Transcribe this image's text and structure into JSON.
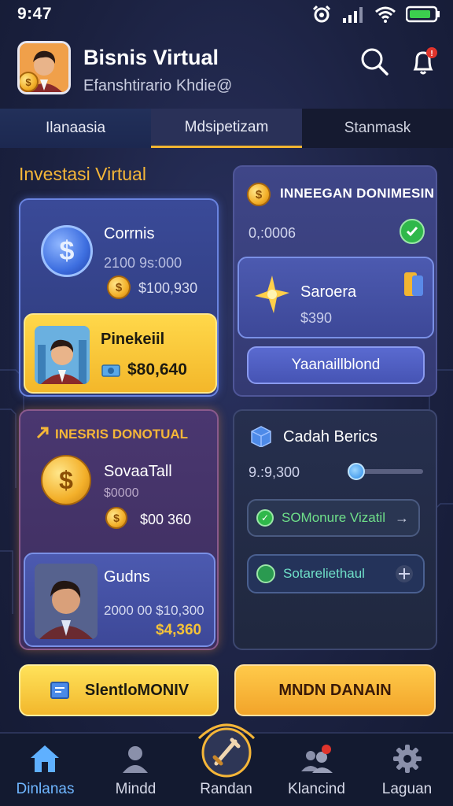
{
  "status_bar": {
    "time": "9:47"
  },
  "header": {
    "title": "Bisnis Virtual",
    "subtitle": "Efanshtirario Khdie@"
  },
  "tabs": [
    {
      "label": "Ilanaasia"
    },
    {
      "label": "Mdsipetizam"
    },
    {
      "label": "Stanmask"
    }
  ],
  "section_title": "Investasi Virtual",
  "card_currency": {
    "title": "Corrnis",
    "value1": "2100 9s:000",
    "value2": "$100,930"
  },
  "card_yellow": {
    "title": "Pinekeiil",
    "value": "$80,640"
  },
  "card_investment": {
    "title": "INNEEGAN DONIMESIN",
    "value": "0,:0006",
    "inner_title": "Saroera",
    "inner_value": "$390",
    "button_label": "Yaanaillblond"
  },
  "card_purple": {
    "title": "INESRIS DONOTUAL",
    "item_title": "SovaaTall",
    "item_sub": "$0000",
    "item_value": "$00 360"
  },
  "card_person": {
    "title": "Gudns",
    "value1": "2000 00 $10,300",
    "value2": "$4,360"
  },
  "card_dark": {
    "title": "Cadah Berics",
    "value": "9.:9,300",
    "slider_level": 0.05,
    "option1": "SOMonure Vizatil",
    "option2": "Sotareliethaul"
  },
  "buttons": {
    "left": "SlentloMONIV",
    "right": "MNDN DANAIN"
  },
  "nav": [
    {
      "label": "Dinlanas",
      "icon": "home-icon"
    },
    {
      "label": "Mindd",
      "icon": "person-icon"
    },
    {
      "label": "Randan",
      "icon": "sword-icon"
    },
    {
      "label": "Klancind",
      "icon": "group-icon"
    },
    {
      "label": "Laguan",
      "icon": "gear-icon"
    }
  ],
  "colors": {
    "accent": "#f5b638",
    "active_nav": "#6fb6ff",
    "background": "#1b2140"
  }
}
